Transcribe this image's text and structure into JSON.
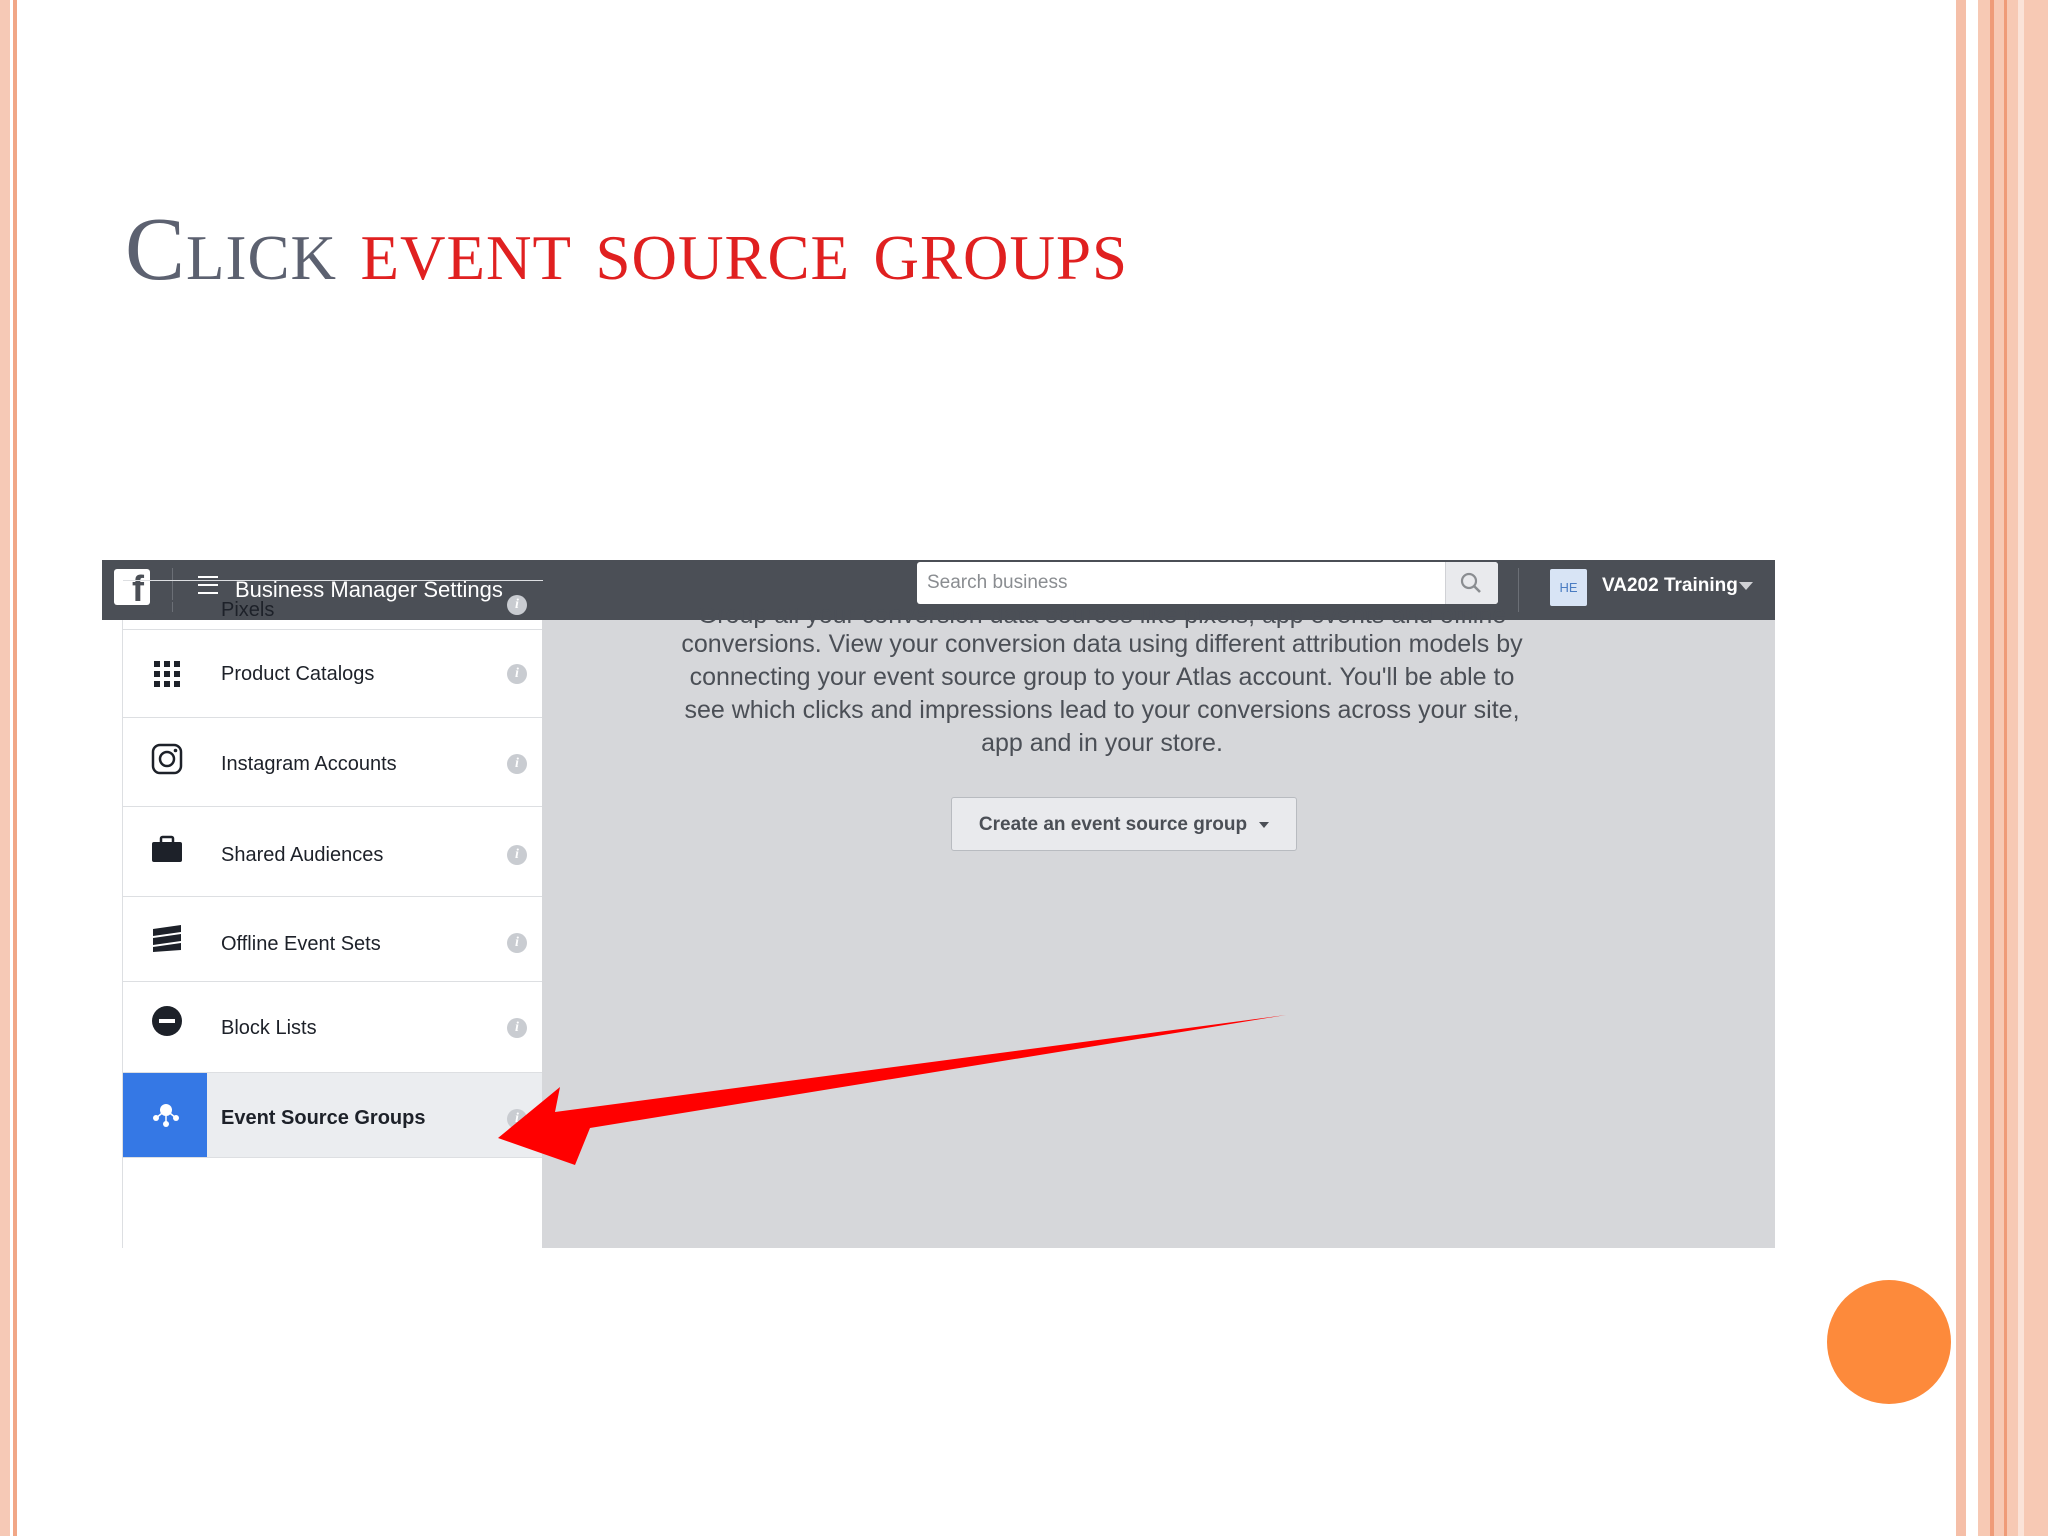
{
  "slide": {
    "title_prefix": "Click",
    "title_highlight": " event source groups"
  },
  "topbar": {
    "app_title": "Business Manager Settings",
    "search_placeholder": "Search business",
    "account_badge": "HE",
    "account_name": "VA202 Training"
  },
  "sidebar": {
    "items": [
      {
        "label": "Pixels",
        "icon": "pixel-icon"
      },
      {
        "label": "Product Catalogs",
        "icon": "grid-icon"
      },
      {
        "label": "Instagram Accounts",
        "icon": "instagram-icon"
      },
      {
        "label": "Shared Audiences",
        "icon": "briefcase-icon"
      },
      {
        "label": "Offline Event Sets",
        "icon": "stack-icon"
      },
      {
        "label": "Block Lists",
        "icon": "block-icon"
      },
      {
        "label": "Event Source Groups",
        "icon": "event-source-icon",
        "active": true
      }
    ],
    "info_glyph": "i"
  },
  "main": {
    "description_line0": "Group all your conversion data sources like pixels, app events and offline",
    "description_line1": "conversions. View your conversion data using different attribution models by",
    "description_line2": "connecting your event source group to your Atlas account. You'll be able to",
    "description_line3": "see which clicks and impressions lead to your conversions across your site,",
    "description_line4": "app and in your store.",
    "create_button": "Create an event source group"
  },
  "colors": {
    "title_gray": "#5c6170",
    "title_red": "#e02020",
    "topbar": "#4b4f56",
    "active_blue": "#3578e5",
    "arrow_red": "#ff0000",
    "accent_orange": "#fd8a3b"
  }
}
